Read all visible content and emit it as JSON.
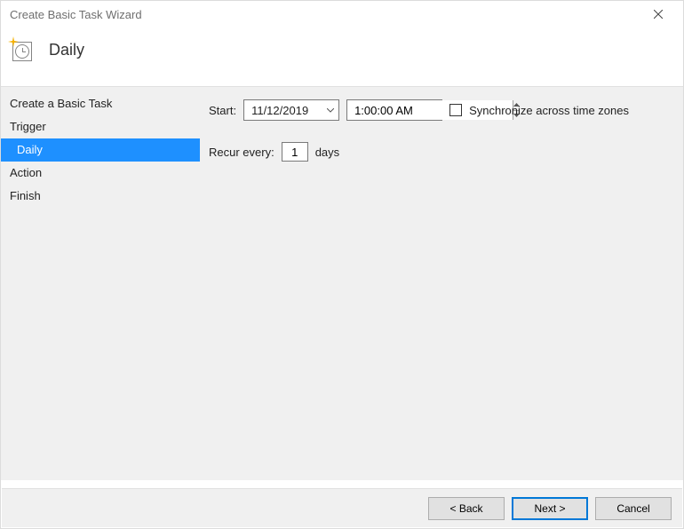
{
  "window": {
    "title": "Create Basic Task Wizard"
  },
  "header": {
    "title": "Daily"
  },
  "nav": {
    "items": [
      {
        "label": "Create a Basic Task",
        "indent": 0,
        "selected": false
      },
      {
        "label": "Trigger",
        "indent": 0,
        "selected": false
      },
      {
        "label": "Daily",
        "indent": 1,
        "selected": true
      },
      {
        "label": "Action",
        "indent": 0,
        "selected": false
      },
      {
        "label": "Finish",
        "indent": 0,
        "selected": false
      }
    ]
  },
  "form": {
    "start_label": "Start:",
    "date_value": "11/12/2019",
    "time_value": "1:00:00 AM",
    "sync_label": "Synchronize across time zones",
    "sync_checked": false,
    "recur_label_left": "Recur every:",
    "recur_value": "1",
    "recur_label_right": "days"
  },
  "buttons": {
    "back": "< Back",
    "next": "Next >",
    "cancel": "Cancel"
  }
}
